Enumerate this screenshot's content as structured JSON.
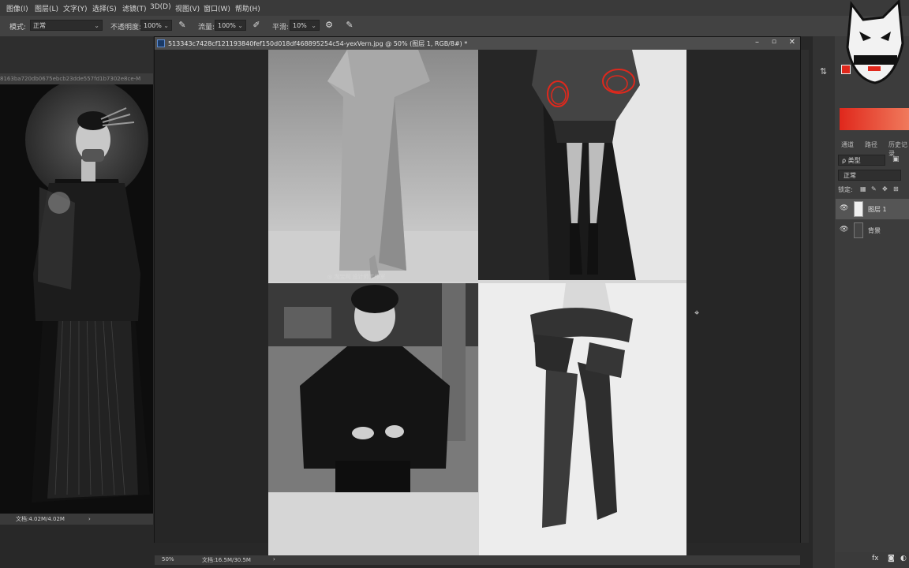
{
  "menu": [
    "图像(I)",
    "图层(L)",
    "文字(Y)",
    "选择(S)",
    "滤镜(T)",
    "3D(D)",
    "视图(V)",
    "窗口(W)",
    "帮助(H)"
  ],
  "options": {
    "mode_label": "模式:",
    "mode_value": "正常",
    "opacity_label": "不透明度:",
    "opacity_value": "100%",
    "flow_label": "流量:",
    "flow_value": "100%",
    "smooth_label": "平滑:",
    "smooth_value": "10%"
  },
  "left_doc": {
    "title": "8163ba720db0675ebcb23dde557fd1b7302e8ce-M",
    "status": "文档:4.02M/4.02M"
  },
  "main_doc": {
    "title": "513343c7428cf121193840fef150d018df468895254c54-yexVern.jpg @ 50% (图层 1, RGB/8#) *",
    "zoom": "50%",
    "status": "文档:16.5M/30.5M",
    "photo_watermark": "◎ 淘宝网 设计师工作室"
  },
  "right_panel": {
    "tabs": [
      "通道",
      "路径",
      "历史记录"
    ],
    "filter_label": "ρ 类型",
    "blend_value": "正常",
    "lock_label": "锁定:",
    "layers": [
      {
        "name": "图层 1"
      },
      {
        "name": "背景"
      }
    ]
  },
  "colors": {
    "accent_red": "#e0281c",
    "panel_bg": "#3c3c3c",
    "menu_bg": "#3a3a3a"
  }
}
